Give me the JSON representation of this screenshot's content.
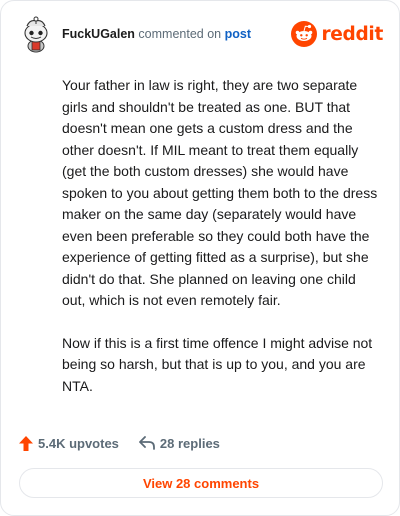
{
  "comment": {
    "username": "FuckUGalen",
    "action_text": "commented on",
    "post_link": "post",
    "paragraphs": [
      "Your father in law is right, they are two separate girls and shouldn't be treated as one. BUT that doesn't mean one gets a custom dress and the other doesn't. If MIL meant to treat them equally (get the both custom dresses) she would have spoken to you about getting them both to the dress maker on the same day (separately would have even been preferable so they could both have the experience of getting fitted as a surprise), but she didn't do that. She planned on leaving one child out, which is not even remotely fair.",
      "Now if this is a first time offence I might advise not being so harsh, but that is up to you, and you are NTA."
    ]
  },
  "brand": {
    "name": "reddit",
    "color": "#ff4500"
  },
  "footer": {
    "upvotes": "5.4K upvotes",
    "replies": "28 replies"
  },
  "view_button": {
    "label": "View 28 comments"
  },
  "icons": {
    "avatar": "avatar-icon",
    "logo": "reddit-logo-icon",
    "upvote": "upvote-arrow-icon",
    "reply": "reply-arrow-icon"
  }
}
